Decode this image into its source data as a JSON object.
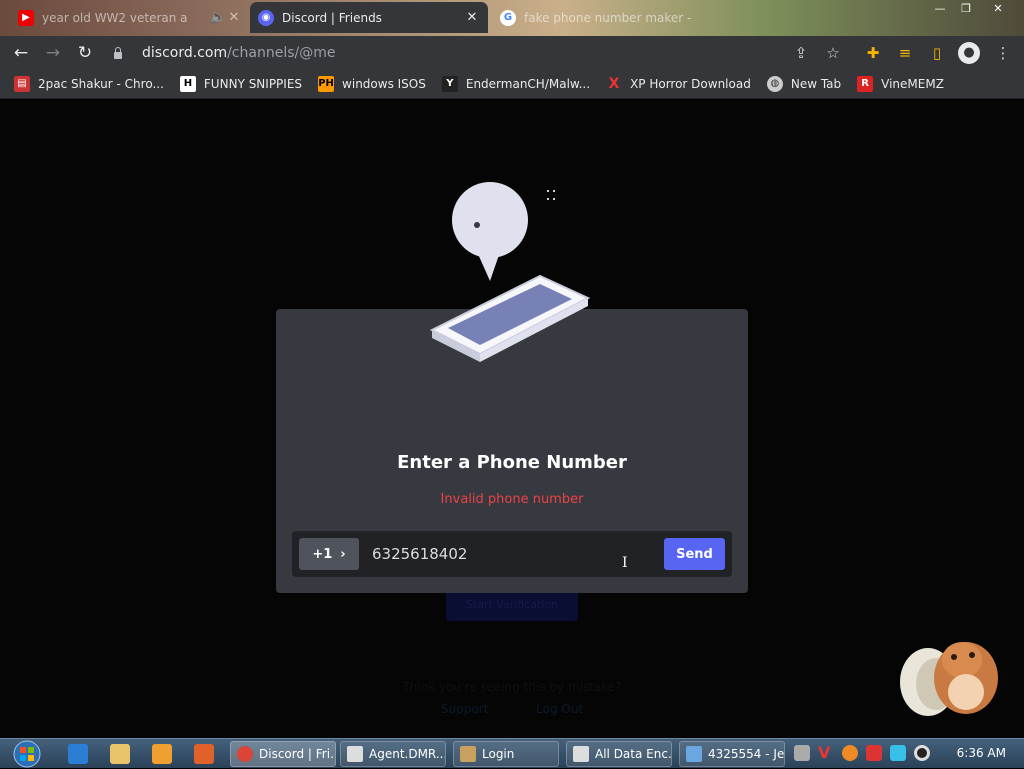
{
  "browser": {
    "tabs": [
      {
        "title": "year old WW2 veteran a",
        "state": "inactive"
      },
      {
        "title": "Discord | Friends",
        "state": "active"
      },
      {
        "title": "fake phone number maker - Go",
        "state": "inactive"
      }
    ],
    "url_host": "discord.com",
    "url_path": "/channels/@me",
    "bookmarks": [
      "2pac Shakur - Chro...",
      "FUNNY SNIPPIES",
      "windows ISOS",
      "EndermanCH/Malw...",
      "XP Horror Download",
      "New Tab",
      "VineMEMZ"
    ]
  },
  "modal": {
    "title": "Enter a Phone Number",
    "error": "Invalid phone number",
    "country_code": "+1",
    "phone_value": "6325618402",
    "send_label": "Send"
  },
  "background_page": {
    "button_label": "Start Verification",
    "footer_text": "Think you're seeing this by mistake?",
    "links": [
      "Support",
      "Log Out"
    ]
  },
  "taskbar": {
    "tasks": [
      "Discord | Fri...",
      "Agent.DMR...",
      "Login",
      "All Data Enc...",
      "4325554 - Je..."
    ],
    "clock": "6:36 AM"
  },
  "colors": {
    "accent": "#5865f2",
    "error": "#ed4245",
    "modal_bg": "#36393f"
  }
}
